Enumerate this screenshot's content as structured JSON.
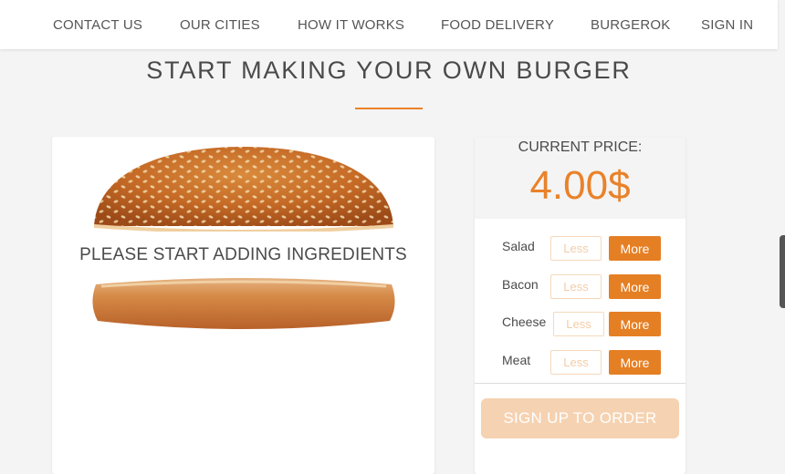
{
  "nav": {
    "items": [
      {
        "label": "CONTACT US"
      },
      {
        "label": "OUR CITIES"
      },
      {
        "label": "HOW IT WORKS"
      },
      {
        "label": "FOOD DELIVERY"
      },
      {
        "label": "BURGEROK"
      },
      {
        "label": "SIGN IN"
      }
    ]
  },
  "page": {
    "title": "START MAKING YOUR OWN BURGER"
  },
  "burger": {
    "empty_message": "PLEASE START ADDING INGREDIENTS"
  },
  "price": {
    "label": "CURRENT PRICE:",
    "value": "4.00$"
  },
  "ingredients": [
    {
      "label": "Salad",
      "less": "Less",
      "more": "More"
    },
    {
      "label": "Bacon",
      "less": "Less",
      "more": "More"
    },
    {
      "label": "Cheese",
      "less": "Less",
      "more": "More"
    },
    {
      "label": "Meat",
      "less": "Less",
      "more": "More"
    }
  ],
  "order_button": "SIGN UP TO ORDER",
  "colors": {
    "accent": "#e9822a",
    "more_button": "#e57f24",
    "order_button_disabled": "#f5d2b1",
    "less_button_text": "#f3cda8"
  }
}
